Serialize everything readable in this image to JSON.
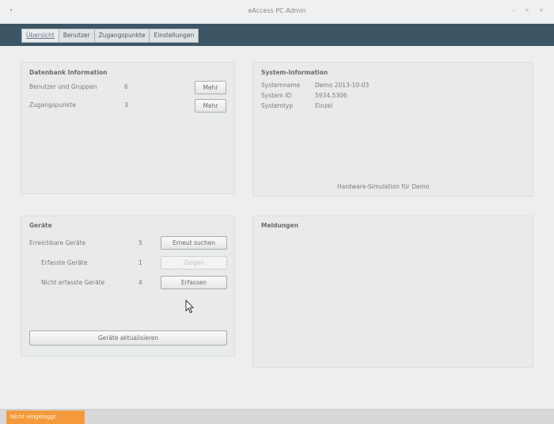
{
  "window": {
    "title": "eAccess PC Admin",
    "menu_glyph": "•",
    "controls": "– + ×"
  },
  "tabs": [
    {
      "label": "Übersicht",
      "active": true
    },
    {
      "label": "Benutzer",
      "active": false
    },
    {
      "label": "Zugangspunkte",
      "active": false
    },
    {
      "label": "Einstellungen",
      "active": false
    }
  ],
  "db_info": {
    "title": "Datenbank Information",
    "rows": [
      {
        "label": "Benutzer und Gruppen",
        "count": "6",
        "button": "Mehr"
      },
      {
        "label": "Zugangspunkte",
        "count": "3",
        "button": "Mehr"
      }
    ]
  },
  "system_info": {
    "title": "System-Information",
    "rows": [
      {
        "label": "Systemname",
        "value": "Demo 2013-10-03"
      },
      {
        "label": "System ID",
        "value": "5934.5306"
      },
      {
        "label": "Systemtyp",
        "value": "Einzel"
      }
    ],
    "note": "Hardware-Simulation für Demo"
  },
  "devices": {
    "title": "Geräte",
    "rows": [
      {
        "label": "Erreichbare Geräte",
        "count": "5",
        "button": "Erneut suchen",
        "enabled": true
      },
      {
        "label": "Erfasste Geräte",
        "count": "1",
        "button": "Zeigen",
        "enabled": false
      },
      {
        "label": "Nicht erfasste Geräte",
        "count": "4",
        "button": "Erfassen",
        "enabled": true
      }
    ],
    "update_button": "Geräte aktualisieren"
  },
  "messages": {
    "title": "Meldungen"
  },
  "status": {
    "badge": "Nicht eingeloggt",
    "badge_color": "#f59a3c"
  },
  "colors": {
    "tabbar": "#3d5666",
    "panel": "#e8eaeb"
  }
}
